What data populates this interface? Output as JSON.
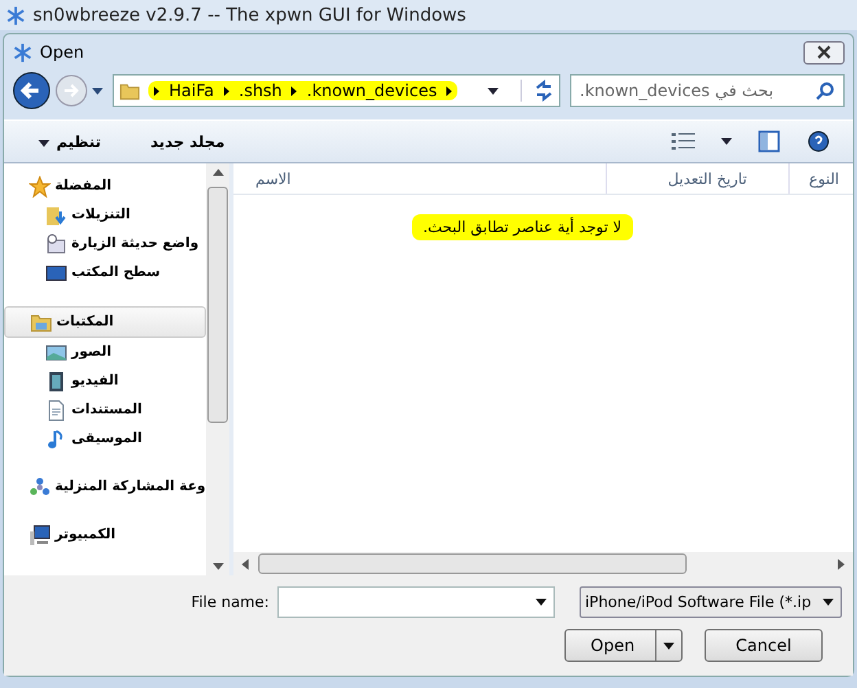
{
  "app_title": "sn0wbreeze v2.9.7 -- The xpwn GUI for Windows",
  "dialog": {
    "title": "Open"
  },
  "breadcrumb": [
    ".known_devices",
    ".shsh",
    "HaiFa"
  ],
  "search": {
    "placeholder": ".known_devices بحث في"
  },
  "toolbar": {
    "organize": "تنظيم",
    "new_folder": "مجلد جديد"
  },
  "nav": [
    {
      "label": "المفضلة",
      "kind": "section",
      "selected": false
    },
    {
      "label": "التنزيلات",
      "kind": "item",
      "selected": false
    },
    {
      "label": "واضع حديثة الزيارة",
      "kind": "item",
      "selected": false
    },
    {
      "label": "سطح المكتب",
      "kind": "item",
      "selected": false
    },
    {
      "label": "المكتبات",
      "kind": "section",
      "selected": true
    },
    {
      "label": "الصور",
      "kind": "item",
      "selected": false
    },
    {
      "label": "الفيديو",
      "kind": "item",
      "selected": false
    },
    {
      "label": "المستندات",
      "kind": "item",
      "selected": false
    },
    {
      "label": "الموسيقى",
      "kind": "item",
      "selected": false
    },
    {
      "label": "وعة المشاركة المنزلية",
      "kind": "section",
      "selected": false
    },
    {
      "label": "الكمبيوتر",
      "kind": "section",
      "selected": false
    }
  ],
  "columns": [
    "النوع",
    "تاريخ التعديل",
    "الاسم"
  ],
  "empty_message": "لا توجد أية عناصر تطابق البحث.",
  "file_name": {
    "label": "File name:"
  },
  "file_type": "iPhone/iPod Software File (*.ip",
  "buttons": {
    "open": "Open",
    "cancel": "Cancel"
  }
}
